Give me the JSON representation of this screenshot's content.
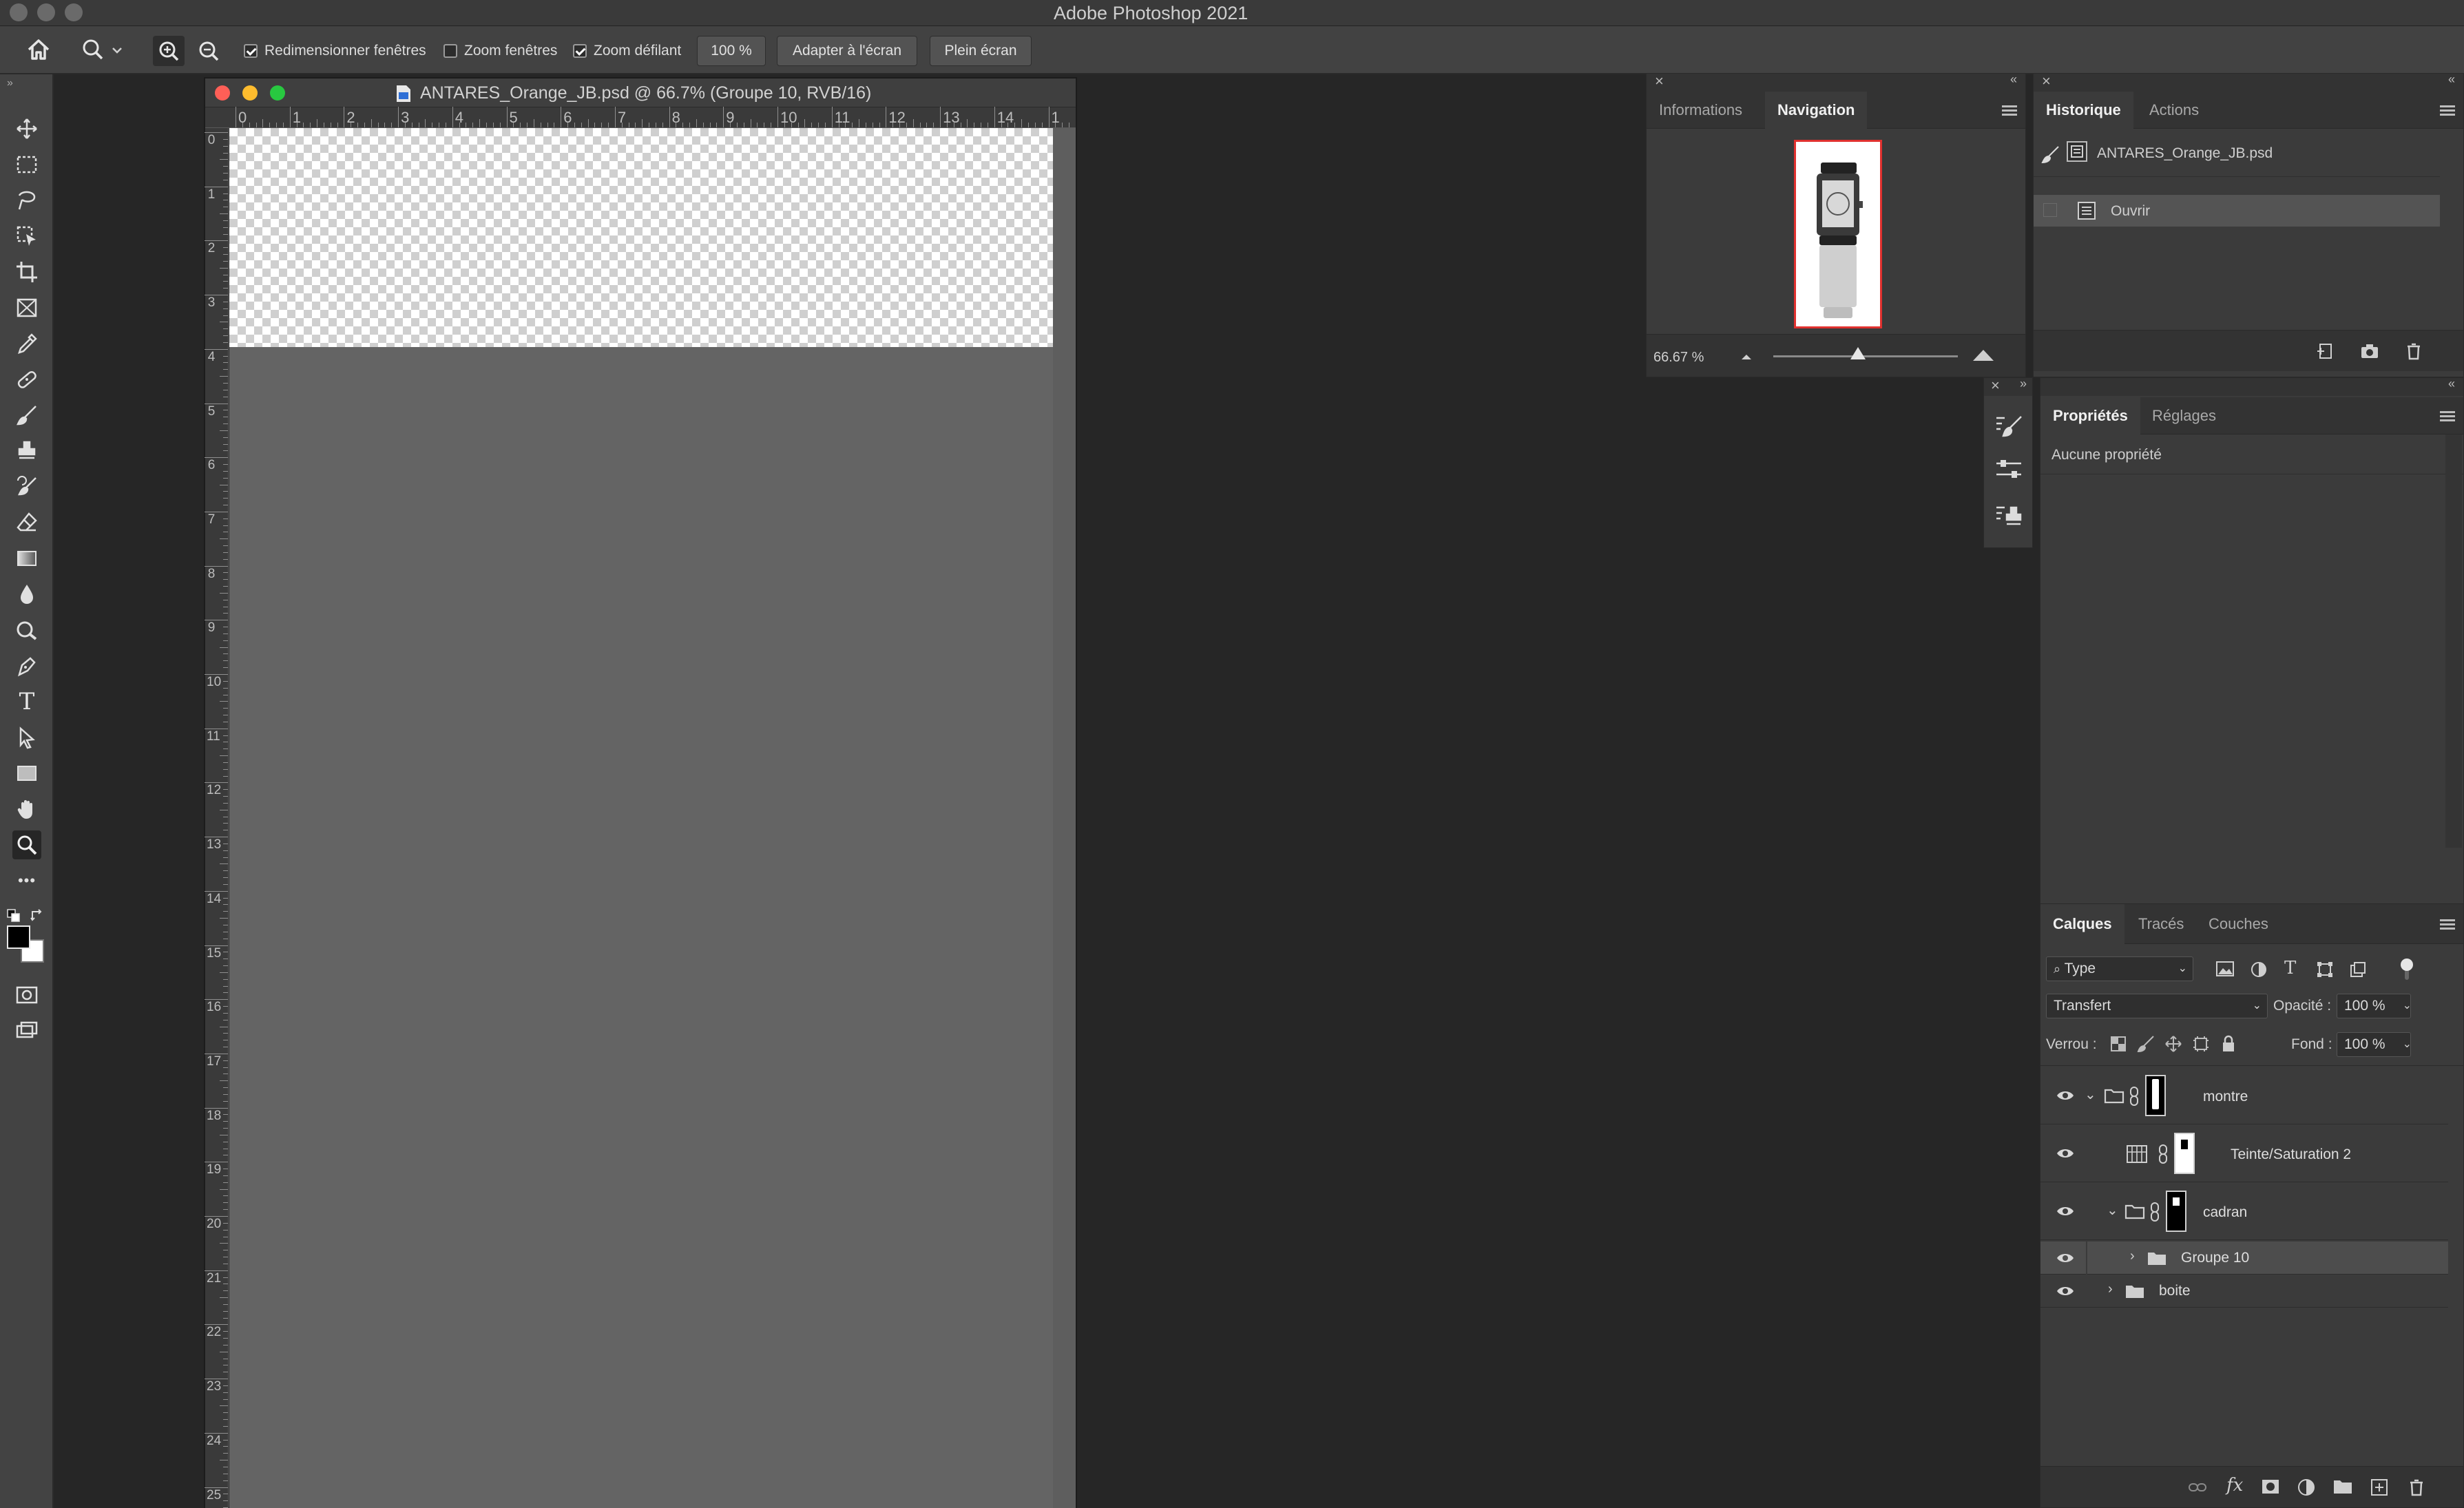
{
  "app": {
    "title": "Adobe Photoshop 2021"
  },
  "options_bar": {
    "resize_windows": {
      "label": "Redimensionner fenêtres",
      "checked": true
    },
    "zoom_windows": {
      "label": "Zoom fenêtres",
      "checked": false
    },
    "scrubby_zoom": {
      "label": "Zoom défilant",
      "checked": true
    },
    "zoom_100": "100 %",
    "fit_screen": "Adapter à l'écran",
    "fill_screen": "Plein écran"
  },
  "toolbar": {
    "tools": [
      "move-icon",
      "marquee-icon",
      "lasso-icon",
      "object-select-icon",
      "crop-icon",
      "frame-icon",
      "eyedropper-icon",
      "healing-icon",
      "brush-icon",
      "stamp-icon",
      "history-brush-icon",
      "eraser-icon",
      "gradient-icon",
      "blur-icon",
      "dodge-icon",
      "pen-icon",
      "type-icon",
      "path-select-icon",
      "rectangle-icon",
      "hand-icon",
      "zoom-icon",
      "more-icon"
    ],
    "active_tool": "zoom-icon",
    "type_tool_glyph": "T",
    "more_glyph": "•••"
  },
  "document": {
    "title": "ANTARES_Orange_JB.psd @ 66.7% (Groupe 10, RVB/16)",
    "ruler_h": [
      "0",
      "1",
      "2",
      "3",
      "4",
      "5",
      "6",
      "7",
      "8",
      "9",
      "10",
      "11",
      "12",
      "13",
      "14",
      "1"
    ],
    "ruler_v": [
      "0",
      "1",
      "2",
      "3",
      "4",
      "5",
      "6",
      "7",
      "8",
      "9",
      "10",
      "11",
      "12",
      "13",
      "14",
      "15",
      "16",
      "17",
      "18",
      "19",
      "20",
      "21",
      "22",
      "23",
      "24",
      "25"
    ]
  },
  "navigation_panel": {
    "tabs": [
      {
        "label": "Informations",
        "active": false
      },
      {
        "label": "Navigation",
        "active": true
      }
    ],
    "zoom": "66.67 %",
    "slider": 0.46
  },
  "history_panel": {
    "tabs": [
      {
        "label": "Historique",
        "active": true
      },
      {
        "label": "Actions",
        "active": false
      }
    ],
    "snapshot": "ANTARES_Orange_JB.psd",
    "states": [
      "Ouvrir"
    ]
  },
  "properties_panel": {
    "tabs": [
      {
        "label": "Propriétés",
        "active": true
      },
      {
        "label": "Réglages",
        "active": false
      }
    ],
    "empty_text": "Aucune propriété"
  },
  "layers_panel": {
    "tabs": [
      {
        "label": "Calques",
        "active": true
      },
      {
        "label": "Tracés",
        "active": false
      },
      {
        "label": "Couches",
        "active": false
      }
    ],
    "filter": "Type",
    "blend_mode": "Transfert",
    "opacity_label": "Opacité :",
    "opacity": "100 %",
    "lock_label": "Verrou :",
    "fill_label": "Fond :",
    "fill": "100 %",
    "layers": [
      {
        "name": "montre",
        "kind": "group",
        "expanded": true
      },
      {
        "name": "Teinte/Saturation 2",
        "kind": "adjustment"
      },
      {
        "name": "cadran",
        "kind": "group",
        "expanded": true
      },
      {
        "name": "Groupe 10",
        "kind": "group",
        "expanded": false,
        "selected": true
      },
      {
        "name": "boite",
        "kind": "group",
        "expanded": false
      }
    ],
    "footer_fx": "fx"
  },
  "colors": {
    "close": "#fe5f57",
    "minimize": "#febc2e",
    "zoom": "#28c840",
    "nav_frame": "#e0312f"
  }
}
